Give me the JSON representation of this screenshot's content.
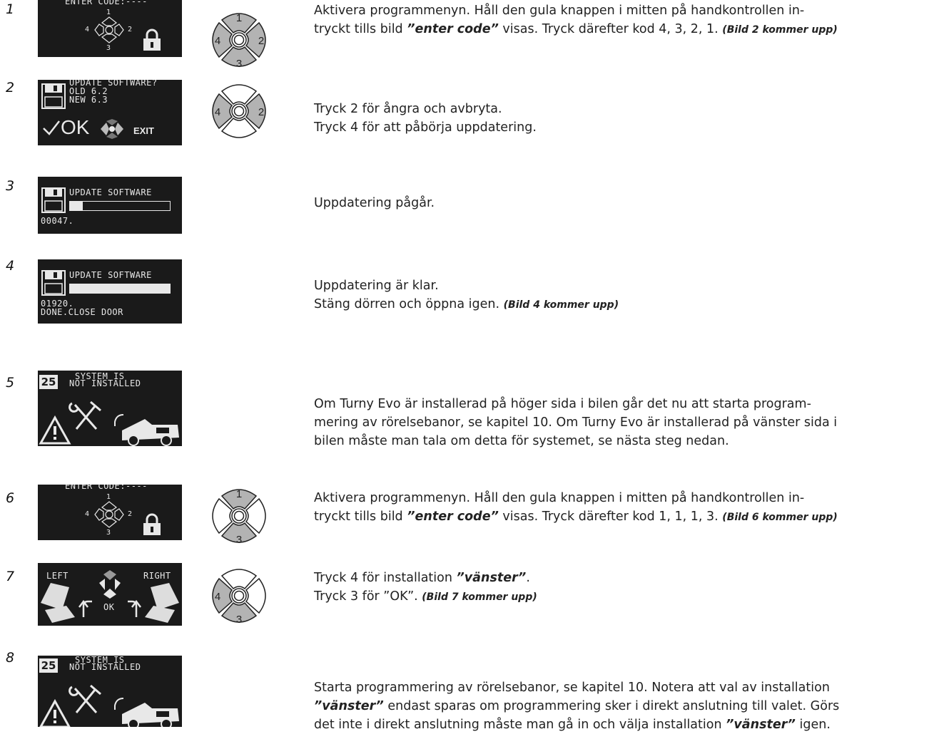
{
  "steps": [
    {
      "num": "1",
      "lcd": {
        "line1": "ENTER CODE:----",
        "up": "1",
        "left": "4",
        "right": "2",
        "down": "3"
      },
      "pad": {
        "up": "1",
        "left": "4",
        "right": "2",
        "down": "3",
        "highlight": [
          "up",
          "left",
          "right",
          "down"
        ]
      },
      "desc_a": "Aktivera programmenyn. Håll den gula knappen i mitten på handkontrollen in-",
      "desc_b_pre": "tryckt tills bild ",
      "desc_b_em": "”enter code”",
      "desc_b_post": " visas. Tryck därefter kod 4, 3, 2, 1. ",
      "desc_note": "(Bild 2 kommer upp)"
    },
    {
      "num": "2",
      "lcd": {
        "line1": "UPDATE SOFTWARE?",
        "line2": "OLD 6.2",
        "line3": "NEW 6.3",
        "ok": "OK",
        "exit": "EXIT"
      },
      "pad": {
        "up": "",
        "left": "4",
        "right": "2",
        "down": "",
        "highlight": [
          "left",
          "right"
        ]
      },
      "desc_a": "Tryck 2 för ångra och avbryta.",
      "desc_b": "Tryck 4 för att påbörja uppdatering."
    },
    {
      "num": "3",
      "lcd": {
        "line1": "UPDATE SOFTWARE",
        "counter": "00047.",
        "progress": 0.13
      },
      "desc_a": "Uppdatering pågår."
    },
    {
      "num": "4",
      "lcd": {
        "line1": "UPDATE SOFTWARE",
        "counter": "01920.",
        "line3": "DONE.CLOSE DOOR",
        "progress": 1.0
      },
      "desc_a": "Uppdatering är klar.",
      "desc_b": "Stäng dörren och öppna igen. ",
      "desc_note": "(Bild 4 kommer upp)"
    },
    {
      "num": "5",
      "lcd": {
        "badge": "25",
        "line1": "SYSTEM IS",
        "line2": "NOT INSTALLED"
      },
      "desc_a": "Om Turny Evo är installerad på höger sida i bilen går det nu att starta program-",
      "desc_b": "mering av rörelsebanor, se kapitel 10. Om Turny Evo är installerad på vänster sida i",
      "desc_c": "bilen måste man tala om detta för systemet, se nästa steg nedan."
    },
    {
      "num": "6",
      "lcd": {
        "line1": "ENTER CODE:----",
        "up": "1",
        "left": "4",
        "right": "2",
        "down": "3"
      },
      "pad": {
        "up": "1",
        "left": "",
        "right": "",
        "down": "3",
        "highlight": [
          "up",
          "down"
        ]
      },
      "desc_a": "Aktivera programmenyn. Håll den gula knappen i mitten på handkontrollen in-",
      "desc_b_pre": "tryckt tills bild ",
      "desc_b_em": "”enter code”",
      "desc_b_post": " visas. Tryck därefter kod 1, 1, 1, 3. ",
      "desc_note": "(Bild 6 kommer upp)"
    },
    {
      "num": "7",
      "lcd": {
        "left": "LEFT",
        "right": "RIGHT",
        "ok": "OK"
      },
      "pad": {
        "up": "",
        "left": "4",
        "right": "",
        "down": "3",
        "highlight": [
          "left",
          "down"
        ]
      },
      "desc_a_pre": "Tryck 4 för installation ",
      "desc_a_em": "”vänster”",
      "desc_a_post": ".",
      "desc_b": "Tryck 3 för ”OK”. ",
      "desc_note": "(Bild 7 kommer upp)"
    },
    {
      "num": "8",
      "lcd": {
        "badge": "25",
        "line1": "SYSTEM IS",
        "line2": "NOT INSTALLED"
      },
      "desc_a": "Starta programmering av rörelsebanor, se kapitel 10. Notera att val av installation",
      "desc_b_em": "”vänster”",
      "desc_b_post": " endast sparas om programmering sker i direkt anslutning till valet. Görs",
      "desc_c_pre": "det inte i direkt anslutning måste man gå in och välja installation ",
      "desc_c_em": "”vänster”",
      "desc_c_post": " igen."
    }
  ],
  "colors": {
    "lcd_bg": "#1a1a1a",
    "lcd_fg": "#e8e8e8",
    "pad_active": "#b3b3b3",
    "pad_inactive": "#ffffff"
  }
}
